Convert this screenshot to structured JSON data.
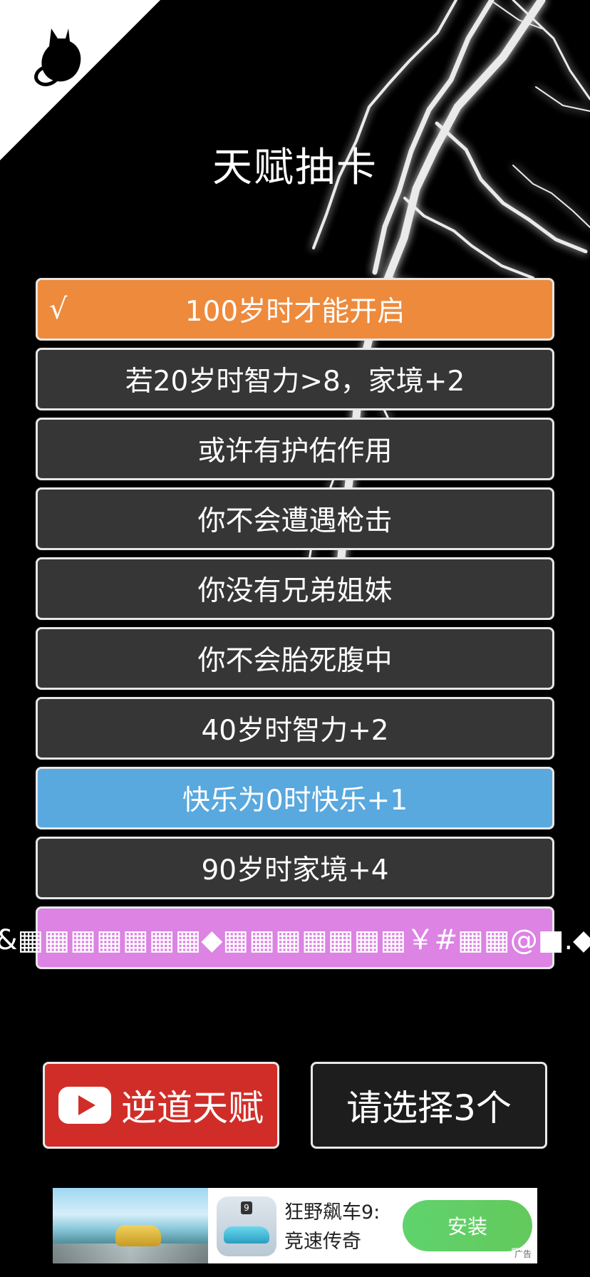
{
  "header": {
    "title": "天赋抽卡"
  },
  "talents": [
    {
      "label": "100岁时才能开启",
      "selected_mark": "√",
      "color": "#ee8a3c"
    },
    {
      "label": "若20岁时智力>8，家境+2",
      "color": "#363636"
    },
    {
      "label": "或许有护佑作用",
      "color": "#363636"
    },
    {
      "label": "你不会遭遇枪击",
      "color": "#363636"
    },
    {
      "label": "你没有兄弟姐妹",
      "color": "#363636"
    },
    {
      "label": "你不会胎死腹中",
      "color": "#363636"
    },
    {
      "label": "40岁时智力+2",
      "color": "#363636"
    },
    {
      "label": "快乐为0时快乐+1",
      "color": "#59a8de"
    },
    {
      "label": "90岁时家境+4",
      "color": "#363636"
    },
    {
      "label": "&▦▦▦▦▦▦▦◆▦▦▦▦▦▦▦￥#▦▦@■.◆",
      "color": "#dc83e4"
    }
  ],
  "actions": {
    "reverse_talent": "逆道天赋",
    "select_prompt": "请选择3个"
  },
  "ad": {
    "headline": "狂野飙车9:",
    "subheadline": "竞速传奇",
    "install_label": "安装",
    "tag": "广告"
  }
}
